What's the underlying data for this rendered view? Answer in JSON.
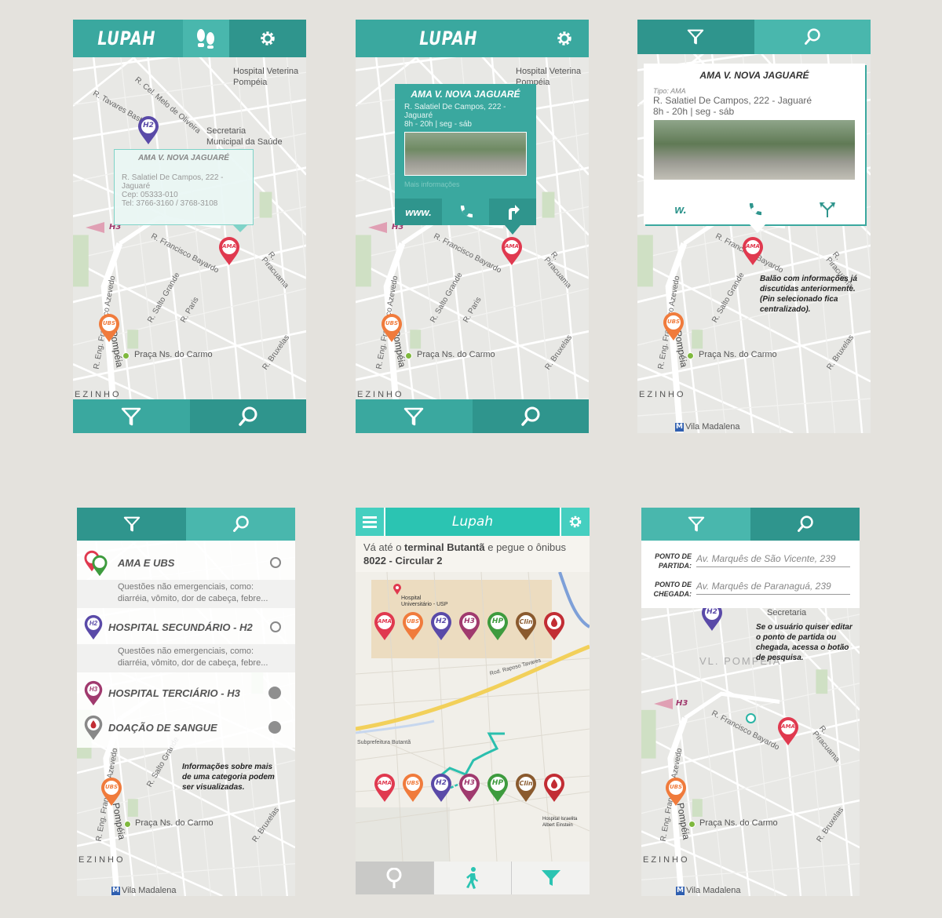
{
  "app": {
    "logo": "LUPAH"
  },
  "map": {
    "labels": {
      "hospital_vet": "Hospital Veterina",
      "pompeia": "Pompéia",
      "secretaria": "Secretaria",
      "municipal_saude": "Municipal da Saúde",
      "praca": "Praça Ns. do Carmo",
      "ezinho": "EZINHO",
      "vila_madalena": "Vila Madalena",
      "av_pompeia": "Av. Pompéia",
      "r_francisco_bayardo": "R. Francisco Bayardo",
      "r_caiuba": "R. Caiubá",
      "r_salto_grande": "R. Salto Grande",
      "r_paris": "R. Paris",
      "r_cayowaa": "R. Cayowaá",
      "r_piracuama": "R. Piracuama",
      "r_bruxelas": "R. Bruxelas",
      "r_tavares_bastos": "R. Tavares Bastos",
      "r_cel_melo": "R. Cel. Melo de Oliveira",
      "r_eng_azevedo": "R. Eng. Francisco Azevedo",
      "r_aimbere": "R. Aimberê",
      "vl_pompeia": "VL. POMPÉIA"
    },
    "pins": {
      "ama": "AMA",
      "ubs": "UBS",
      "h2": "H2",
      "h3": "H3",
      "hp": "HP",
      "clin": "Clin"
    }
  },
  "screen1": {
    "popup": {
      "title": "AMA V. NOVA JAGUARÉ",
      "line1": "R. Salatiel De Campos, 222 -",
      "line2": "Jaguaré",
      "line3": "Cep: 05333-010",
      "line4": "Tel: 3766-3160 / 3768-3108"
    }
  },
  "screen2": {
    "popup": {
      "title": "AMA V. NOVA JAGUARÉ",
      "line1": "R. Salatiel De Campos, 222 -",
      "line2": "Jaguaré",
      "line3": "8h - 20h | seg - sáb",
      "faded": "Mais informações",
      "www": "www."
    }
  },
  "screen3": {
    "popup": {
      "title": "AMA V. NOVA JAGUARÉ",
      "tipo": "Tipo: AMA",
      "line1": "R. Salatiel De Campos, 222 - Jaguaré",
      "line2": "8h - 20h | seg - sáb",
      "www": "w."
    },
    "note": [
      "Balão com informações já",
      "discutidas anteriormente.",
      "(Pin selecionado fica",
      "centralizado)."
    ]
  },
  "screen4": {
    "items": [
      {
        "label": "AMA E UBS",
        "desc1": "Questões não emergenciais, como:",
        "desc2": "diarréia, vômito, dor de cabeça, febre..."
      },
      {
        "label": "HOSPITAL SECUNDÁRIO - H2",
        "desc1": "Questões não emergenciais, como:",
        "desc2": "diarréia, vômito, dor de cabeça, febre..."
      },
      {
        "label": "HOSPITAL TERCIÁRIO - H3"
      },
      {
        "label": "DOAÇÃO DE SANGUE"
      }
    ],
    "note": [
      "Informações sobre mais",
      "de uma categoria podem",
      "ser visualizadas."
    ]
  },
  "screen5": {
    "title": "Lupah",
    "instr_a": "Vá até o ",
    "instr_b": "terminal Butantã",
    "instr_c": " e pegue o ônibus",
    "instr_d": "8022 - Circular 2",
    "hosp_label1": "Hospital",
    "hosp_label2": "Universitário - USP",
    "hosp_label3": "Hospital Israelita",
    "hosp_label4": "Albert Einstein",
    "rod": "Rod. Raposo Tavares",
    "butanta": "Subprefeitura Butantã"
  },
  "screen6": {
    "partida_label1": "PONTO DE",
    "partida_label2": "PARTIDA:",
    "partida_value": "Av. Marquês de São Vicente, 239",
    "chegada_label1": "PONTO DE",
    "chegada_label2": "CHEGADA:",
    "chegada_value": "Av. Marquês de Paranaguá, 239",
    "note": [
      "Se o usuário quiser editar",
      "o ponto de partida ou",
      "chegada, acessa o botão",
      "de pesquisa."
    ]
  },
  "colors": {
    "teal": "#3aa89f",
    "teal_dark": "#2f958d",
    "teal_light": "#49b7ad",
    "ama": "#e0394f",
    "ubs": "#f07b3c",
    "h2": "#5a4aa8",
    "h3": "#a03a6e",
    "hp": "#3e9b3e",
    "clin": "#8a5a2e",
    "blood": "#c22d34"
  }
}
